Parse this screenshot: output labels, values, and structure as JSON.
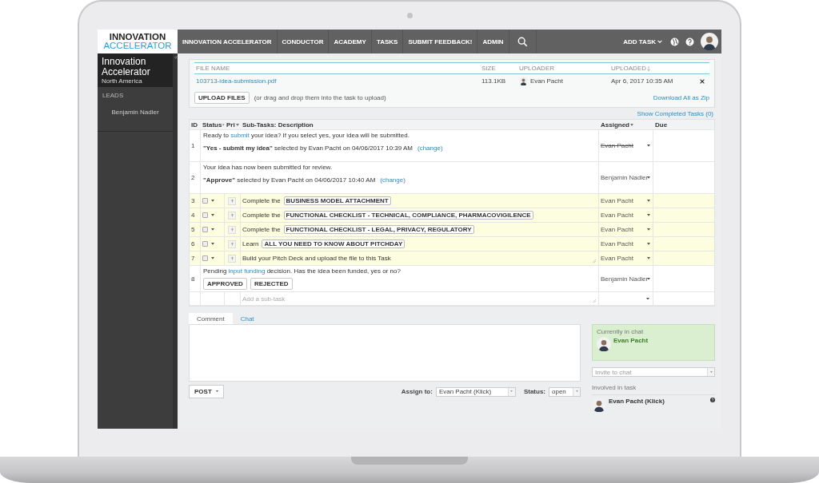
{
  "nav": {
    "logo": {
      "line1": "INNOVATION",
      "line2": "ACCELERATOR"
    },
    "items": [
      "INNOVATION ACCELERATOR",
      "CONDUCTOR",
      "ACADEMY",
      "TASKS",
      "SUBMIT FEEDBACK!",
      "ADMIN"
    ],
    "add_task": "ADD TASK"
  },
  "sidebar": {
    "title": "Innovation Accelerator",
    "subtitle": "North America",
    "section": "LEADS",
    "leads": [
      "Benjamin Nadler"
    ]
  },
  "files": {
    "columns": [
      {
        "label": "FILE NAME",
        "sorted": false
      },
      {
        "label": "SIZE",
        "sorted": false
      },
      {
        "label": "UPLOADER",
        "sorted": false
      },
      {
        "label": "UPLOADED",
        "sorted": true
      }
    ],
    "rows": [
      {
        "name": "103713-idea-submission.pdf",
        "size": "113.1KB",
        "uploader": "Evan Pacht",
        "uploaded": "Apr 6, 2017 10:35 AM"
      }
    ],
    "upload_button": "UPLOAD FILES",
    "hint": "(or drag and drop them into the task to upload)",
    "download_link": "Download All as Zip"
  },
  "show_completed": "Show Completed Tasks (0)",
  "tasks": {
    "columns": [
      {
        "label": "ID",
        "menu": false
      },
      {
        "label": "Status",
        "menu": true
      },
      {
        "label": "Pri",
        "menu": true
      },
      {
        "label": "Sub-Tasks: Description",
        "menu": false
      },
      {
        "label": "Assigned",
        "menu": true
      },
      {
        "label": "Due",
        "menu": false
      }
    ],
    "rows": [
      {
        "kind": "decision",
        "id": "1",
        "prompt": [
          {
            "text": "Ready to "
          },
          {
            "text": "submit",
            "link": true
          },
          {
            "text": " your idea? If you select yes, your idea will be submitted."
          }
        ],
        "choice": "\"Yes - submit my idea\"",
        "detail": "selected by Evan Pacht on 04/06/2017 10:39 AM",
        "change": "(change)",
        "assigned": "Evan Pacht",
        "struck": true
      },
      {
        "kind": "decision",
        "id": "2",
        "prompt": [
          {
            "text": "Your idea has now been submitted for review."
          }
        ],
        "choice": "\"Approve\"",
        "detail": "selected by Evan Pacht on 04/06/2017 10:40 AM",
        "change": "(change)",
        "assigned": "Benjamin Nadler",
        "struck": false
      },
      {
        "kind": "task",
        "id": "3",
        "checked": false,
        "text": "Complete the",
        "tag": "BUSINESS MODEL ATTACHMENT",
        "assigned": "Evan Pacht"
      },
      {
        "kind": "task",
        "id": "4",
        "checked": false,
        "text": "Complete the",
        "tag": "FUNCTIONAL CHECKLIST - TECHNICAL, COMPLIANCE, PHARMACOVIGILENCE",
        "assigned": "Evan Pacht"
      },
      {
        "kind": "task",
        "id": "5",
        "checked": false,
        "text": "Complete the",
        "tag": "FUNCTIONAL CHECKLIST - LEGAL, PRIVACY, REGULATORY",
        "assigned": "Evan Pacht"
      },
      {
        "kind": "task",
        "id": "6",
        "checked": false,
        "text": "Learn",
        "tag": "ALL YOU NEED TO KNOW ABOUT PITCHDAY",
        "assigned": "Evan Pacht"
      },
      {
        "kind": "task",
        "id": "7",
        "checked": false,
        "text": "Build your Pitch Deck and upload the file to this Task",
        "assigned": "Evan Pacht"
      },
      {
        "kind": "pending",
        "id": "8",
        "prompt": [
          {
            "text": "Pending "
          },
          {
            "text": "input funding",
            "link": true
          },
          {
            "text": " decision. Has the idea been funded, yes or no?"
          }
        ],
        "buttons": [
          "APPROVED",
          "REJECTED"
        ],
        "assigned": "Benjamin Nadler"
      }
    ],
    "new_task": {
      "placeholder": "Add a sub-task"
    }
  },
  "comment": {
    "tabs": [
      {
        "label": "Comment",
        "selected": true
      },
      {
        "label": "Chat",
        "selected": false
      }
    ],
    "post": "POST",
    "assign_label": "Assign to:",
    "assign_value": "Evan Pacht (Klick)",
    "status_label": "Status:",
    "status_value": "open"
  },
  "chat": {
    "heading": "Currently in chat",
    "members": [
      "Evan Pacht"
    ],
    "invite_placeholder": "Invite to chat",
    "involved_heading": "Involved in task",
    "involved": [
      "Evan Pacht (Klick)"
    ]
  }
}
